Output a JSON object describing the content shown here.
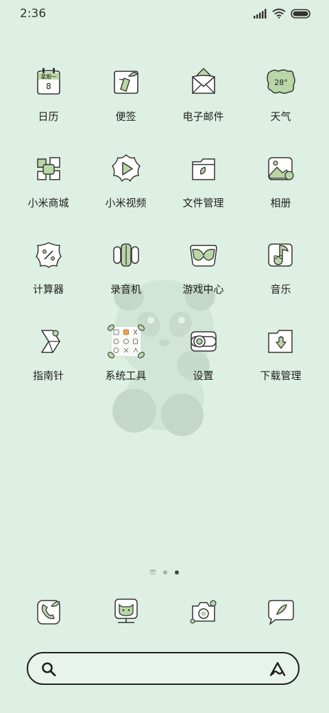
{
  "status_bar": {
    "time": "2:36",
    "icons": [
      "signal-icon",
      "wifi-icon",
      "battery-icon"
    ]
  },
  "apps": [
    {
      "label": "日历",
      "icon": "calendar-icon",
      "calendar_weekday": "星期一",
      "calendar_day": "8"
    },
    {
      "label": "便签",
      "icon": "notes-icon"
    },
    {
      "label": "电子邮件",
      "icon": "email-icon"
    },
    {
      "label": "天气",
      "icon": "weather-icon",
      "weather_temp": "28°"
    },
    {
      "label": "小米商城",
      "icon": "mi-store-icon"
    },
    {
      "label": "小米视频",
      "icon": "mi-video-icon"
    },
    {
      "label": "文件管理",
      "icon": "file-manager-icon"
    },
    {
      "label": "相册",
      "icon": "gallery-icon"
    },
    {
      "label": "计算器",
      "icon": "calculator-icon"
    },
    {
      "label": "录音机",
      "icon": "recorder-icon"
    },
    {
      "label": "游戏中心",
      "icon": "game-center-icon"
    },
    {
      "label": "音乐",
      "icon": "music-icon"
    },
    {
      "label": "指南针",
      "icon": "compass-icon"
    },
    {
      "label": "系统工具",
      "icon": "folder-icon"
    },
    {
      "label": "设置",
      "icon": "settings-icon"
    },
    {
      "label": "下载管理",
      "icon": "downloads-icon"
    }
  ],
  "page_indicator": {
    "pages": 3,
    "current": 3
  },
  "dock": [
    {
      "icon": "phone-icon"
    },
    {
      "icon": "webcam-icon"
    },
    {
      "icon": "camera-icon"
    },
    {
      "icon": "messages-icon"
    }
  ],
  "search": {
    "left_icon": "search-icon",
    "right_icon": "assistant-icon"
  },
  "colors": {
    "background": "#deefe3",
    "accent": "#b9d6a6",
    "outline": "#333333"
  }
}
